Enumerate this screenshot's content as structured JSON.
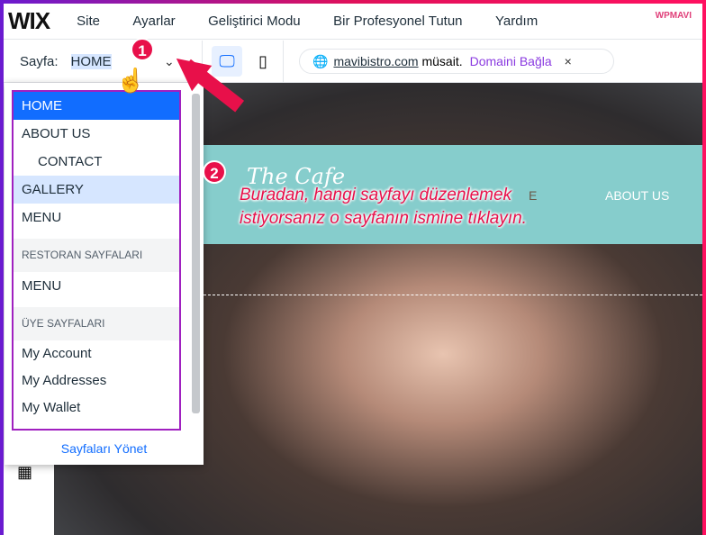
{
  "topbar": {
    "logo": "WIX",
    "menu": [
      "Site",
      "Ayarlar",
      "Geliştirici Modu",
      "Bir Profesyonel Tutun",
      "Yardım"
    ],
    "watermark": "WPMAVI"
  },
  "pagebar": {
    "label": "Sayfa:",
    "current": "HOME",
    "domain": "mavibistro.com",
    "available": "müsait.",
    "connect": "Domaini Bağla",
    "close": "×"
  },
  "pages": {
    "main": [
      "HOME",
      "ABOUT US",
      "CONTACT",
      "GALLERY",
      "MENU"
    ],
    "section1": "RESTORAN SAYFALARI",
    "section1_items": [
      "MENU"
    ],
    "section2": "ÜYE SAYFALARI",
    "section2_items": [
      "My Account",
      "My Addresses",
      "My Wallet"
    ],
    "manage": "Sayfaları Yönet"
  },
  "site": {
    "brand": "The Cafe",
    "nav_partial": "E",
    "nav_about": "ABOUT US"
  },
  "annotations": {
    "badge1": "1",
    "badge2": "2",
    "callout_line1": "Buradan, hangi sayfayı düzenlemek",
    "callout_line2": "istiyorsanız o sayfanın ismine tıklayın."
  },
  "colors": {
    "accent": "#116dff",
    "annotation": "#e8104a",
    "frame": "#a020c0"
  }
}
